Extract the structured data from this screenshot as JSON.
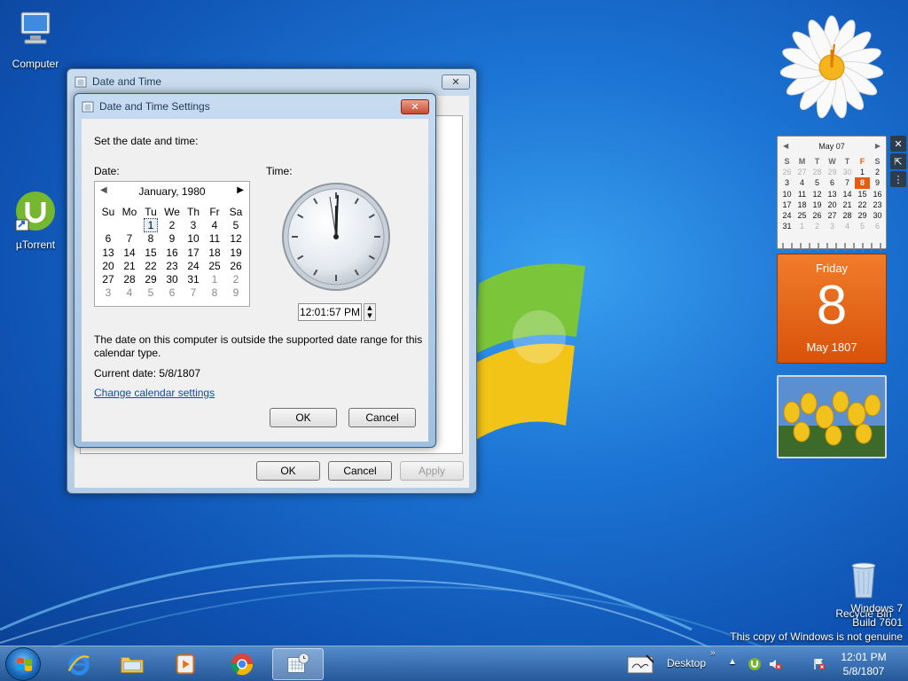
{
  "desktop": {
    "icons": [
      {
        "label": "Computer"
      },
      {
        "label": "µTorrent"
      },
      {
        "label": "Recycle Bin"
      }
    ],
    "watermark": {
      "line1": "Windows 7",
      "line2": "Build 7601",
      "line3": "This copy of Windows is not genuine"
    }
  },
  "outer_window": {
    "title": "Date and Time",
    "close": "✕",
    "ok": "OK",
    "cancel": "Cancel",
    "apply": "Apply"
  },
  "dialog": {
    "title": "Date and Time Settings",
    "close": "✕",
    "prompt": "Set the date and time:",
    "date_label": "Date:",
    "time_label": "Time:",
    "calendar": {
      "month_year": "January, 1980",
      "weekdays": [
        "Su",
        "Mo",
        "Tu",
        "We",
        "Th",
        "Fr",
        "Sa"
      ],
      "rows": [
        [
          "",
          "",
          "1",
          "2",
          "3",
          "4",
          "5"
        ],
        [
          "6",
          "7",
          "8",
          "9",
          "10",
          "11",
          "12"
        ],
        [
          "13",
          "14",
          "15",
          "16",
          "17",
          "18",
          "19"
        ],
        [
          "20",
          "21",
          "22",
          "23",
          "24",
          "25",
          "26"
        ],
        [
          "27",
          "28",
          "29",
          "30",
          "31",
          "1",
          "2"
        ],
        [
          "3",
          "4",
          "5",
          "6",
          "7",
          "8",
          "9"
        ]
      ],
      "selected": "1"
    },
    "time_value": "12:01:57 PM",
    "message": "The date on this computer is outside the supported date range for this calendar type.",
    "current_date": "Current date: 5/8/1807",
    "change_link": "Change calendar settings",
    "ok": "OK",
    "cancel": "Cancel"
  },
  "gadgets": {
    "mini_calendar": {
      "header": "May 07",
      "weekdays": [
        "S",
        "M",
        "T",
        "W",
        "T",
        "F",
        "S"
      ],
      "rows": [
        [
          "26",
          "27",
          "28",
          "29",
          "30",
          "1",
          "2"
        ],
        [
          "3",
          "4",
          "5",
          "6",
          "7",
          "8",
          "9"
        ],
        [
          "10",
          "11",
          "12",
          "13",
          "14",
          "15",
          "16"
        ],
        [
          "17",
          "18",
          "19",
          "20",
          "21",
          "22",
          "23"
        ],
        [
          "24",
          "25",
          "26",
          "27",
          "28",
          "29",
          "30"
        ],
        [
          "31",
          "1",
          "2",
          "3",
          "4",
          "5",
          "6"
        ]
      ]
    },
    "day_card": {
      "weekday": "Friday",
      "day": "8",
      "month_year": "May 1807"
    }
  },
  "taskbar": {
    "desktop_label": "Desktop",
    "time": "12:01 PM",
    "date": "5/8/1807"
  },
  "colors": {
    "accent_orange": "#e85a0f",
    "link_blue": "#0b4ea8"
  }
}
